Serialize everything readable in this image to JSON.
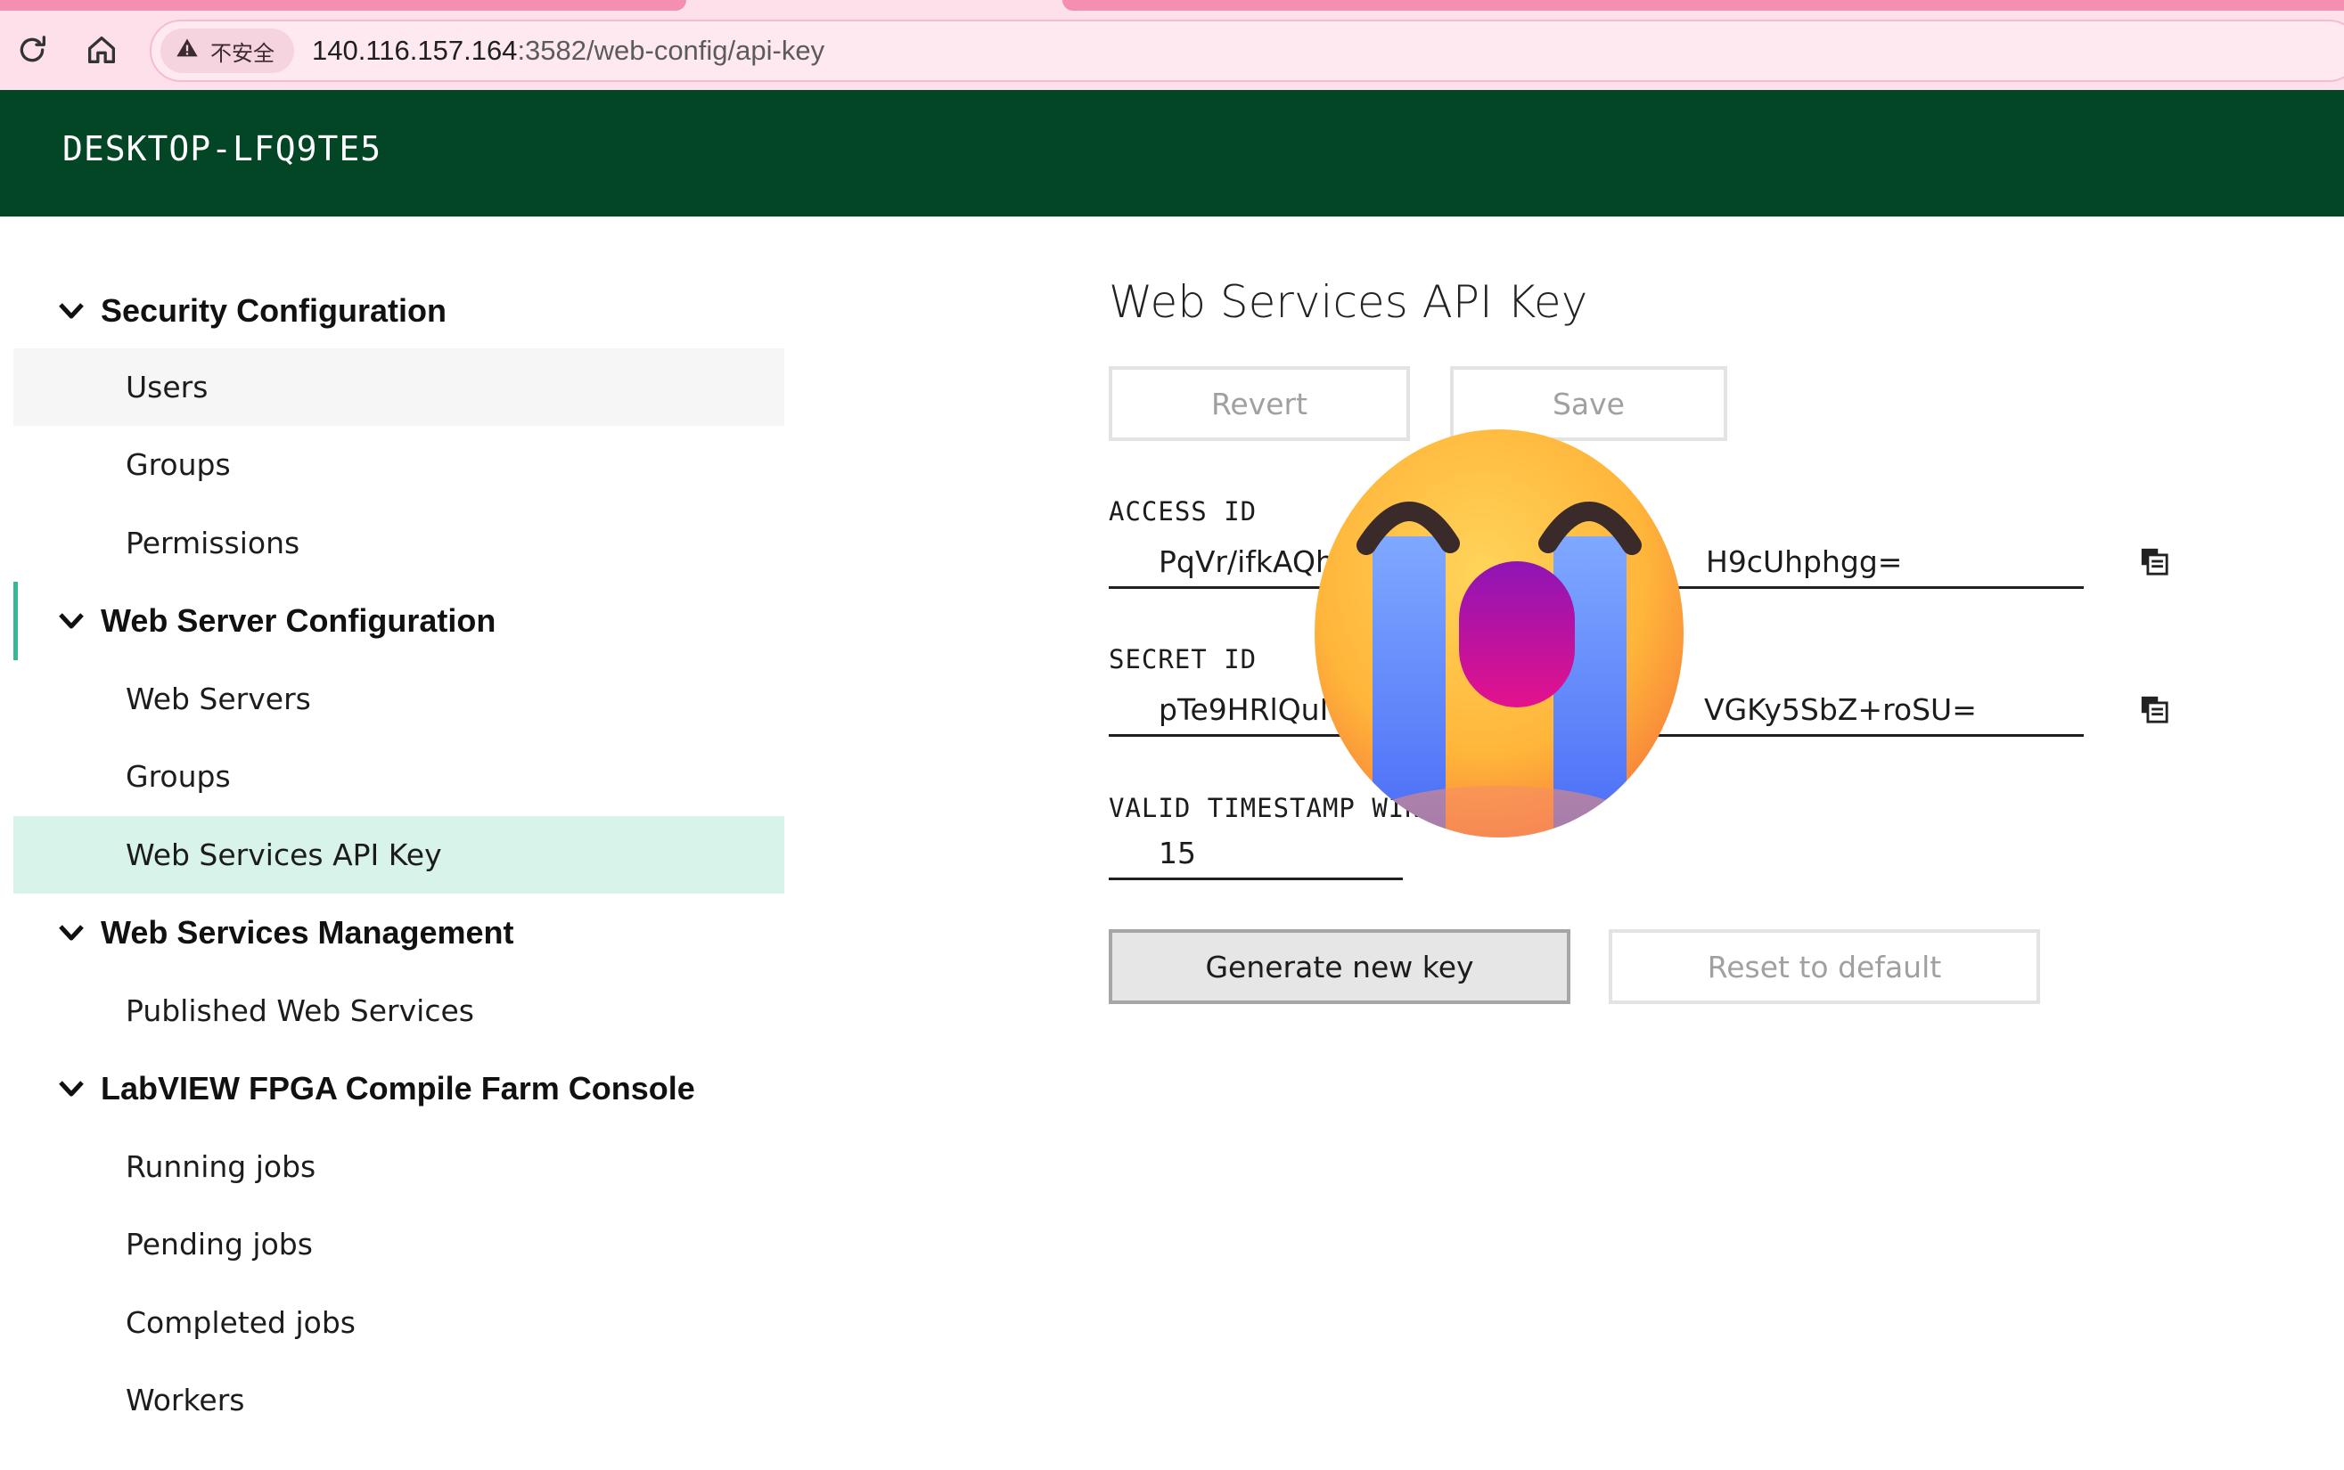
{
  "browser": {
    "security_label": "不安全",
    "url_host": "140.116.157.164",
    "url_path": ":3582/web-config/api-key",
    "icons": [
      "reload-icon",
      "home-icon",
      "warning-icon"
    ]
  },
  "header": {
    "host_name": "DESKTOP-LFQ9TE5"
  },
  "sidebar": {
    "sections": [
      {
        "label": "Security Configuration",
        "items": [
          "Users",
          "Groups",
          "Permissions"
        ]
      },
      {
        "label": "Web Server Configuration",
        "items": [
          "Web Servers",
          "Groups",
          "Web Services API Key"
        ]
      },
      {
        "label": "Web Services Management",
        "items": [
          "Published Web Services"
        ]
      },
      {
        "label": "LabVIEW FPGA Compile Farm Console",
        "items": [
          "Running jobs",
          "Pending jobs",
          "Completed jobs",
          "Workers"
        ]
      }
    ],
    "selected_item": "Web Services API Key",
    "hovered_item": "Users"
  },
  "main": {
    "title": "Web Services API Key",
    "toolbar": {
      "revert_label": "Revert",
      "save_label": "Save"
    },
    "access_id": {
      "label": "ACCESS ID",
      "value_start": "PqVr/ifkAQh",
      "value_end": "H9cUhphgg="
    },
    "secret_id": {
      "label": "SECRET ID",
      "value_start": "pTe9HRlQuI",
      "value_end": "VGKy5SbZ+roSU="
    },
    "timestamp_window": {
      "label": "VALID TIMESTAMP WIN",
      "value": "15"
    },
    "actions": {
      "generate_label": "Generate new key",
      "reset_label": "Reset to default"
    }
  },
  "colors": {
    "header_bg": "#034626",
    "browser_bg": "#fde0ea",
    "selected_bg": "#d8f3ea",
    "accent": "#37b894"
  }
}
